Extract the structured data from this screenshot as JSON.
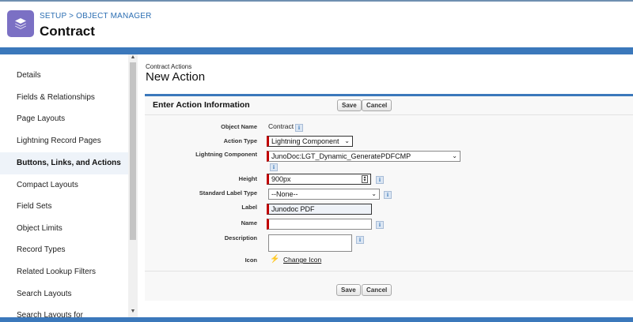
{
  "header": {
    "breadcrumb_setup": "SETUP",
    "breadcrumb_sep": " > ",
    "breadcrumb_object_manager": "OBJECT MANAGER",
    "title": "Contract",
    "icon": "layers-icon"
  },
  "sidebar": {
    "items": [
      {
        "label": "Details"
      },
      {
        "label": "Fields & Relationships"
      },
      {
        "label": "Page Layouts"
      },
      {
        "label": "Lightning Record Pages"
      },
      {
        "label": "Buttons, Links, and Actions",
        "active": true
      },
      {
        "label": "Compact Layouts"
      },
      {
        "label": "Field Sets"
      },
      {
        "label": "Object Limits"
      },
      {
        "label": "Record Types"
      },
      {
        "label": "Related Lookup Filters"
      },
      {
        "label": "Search Layouts"
      },
      {
        "label": "Search Layouts for"
      }
    ]
  },
  "main": {
    "subtitle": "Contract Actions",
    "title": "New Action",
    "panel_title": "Enter Action Information",
    "save_label": "Save",
    "cancel_label": "Cancel",
    "fields": {
      "object_name_label": "Object Name",
      "object_name_value": "Contract",
      "action_type_label": "Action Type",
      "action_type_value": "Lightning Component",
      "lightning_component_label": "Lightning Component",
      "lightning_component_value": "JunoDoc:LGT_Dynamic_GeneratePDFCMP",
      "height_label": "Height",
      "height_value": "900px",
      "standard_label_type_label": "Standard Label Type",
      "standard_label_type_value": "--None--",
      "label_label": "Label",
      "label_value": "Junodoc PDF",
      "name_label": "Name",
      "name_value": "",
      "description_label": "Description",
      "icon_label": "Icon",
      "change_icon_label": "Change Icon"
    },
    "info_glyph": "i"
  },
  "colors": {
    "brand_blue": "#3b78bb",
    "icon_purple": "#7b70c4",
    "required_red": "#c00000",
    "link_blue": "#2d6fb3"
  }
}
